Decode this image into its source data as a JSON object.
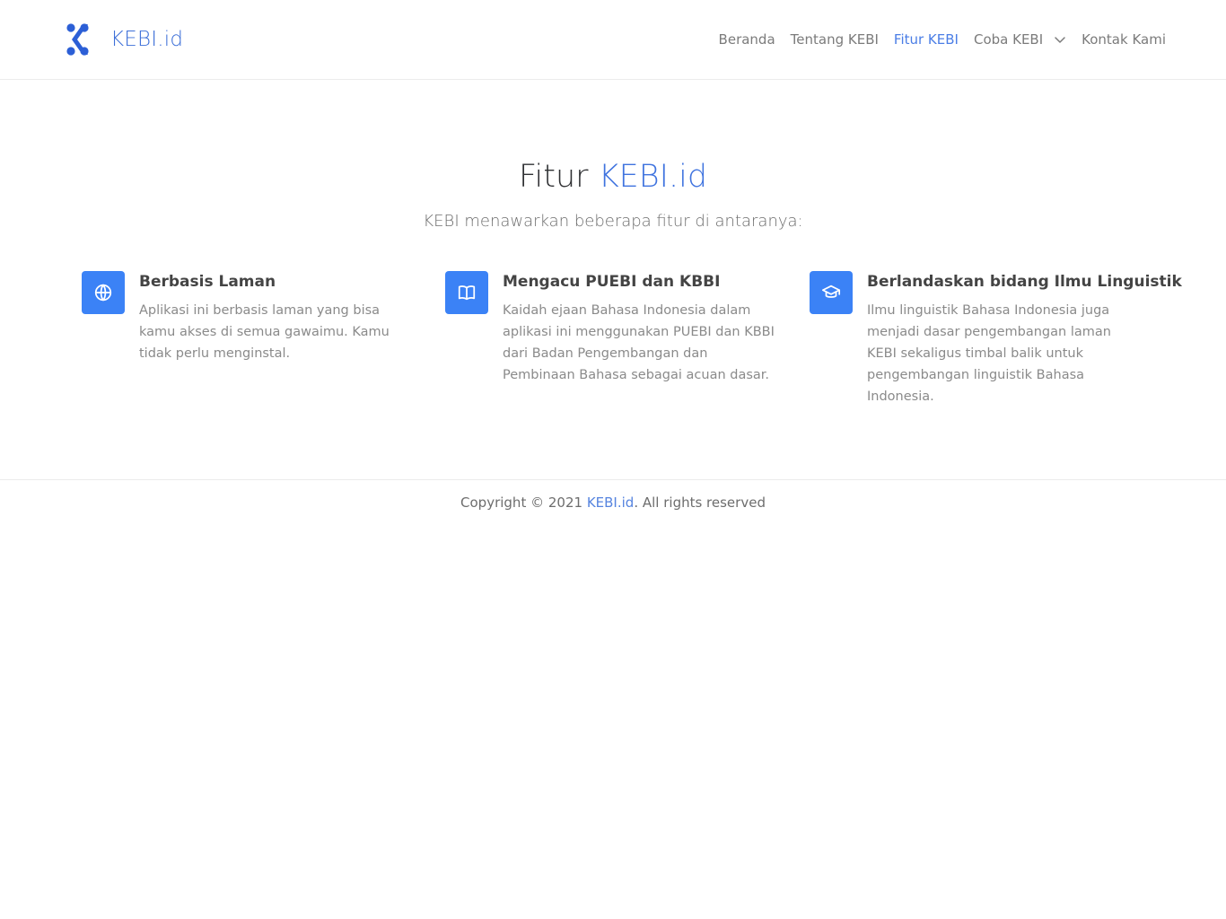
{
  "header": {
    "brand_name": "KEBI.id",
    "logo_icon": "kebi-logo-icon",
    "nav": [
      {
        "label": "Beranda"
      },
      {
        "label": "Tentang KEBI"
      },
      {
        "label": "Fitur KEBI",
        "active": true
      },
      {
        "label": "Coba KEBI",
        "has_dropdown": true,
        "dropdown_icon": "chevron-down-icon"
      },
      {
        "label": "Kontak Kami"
      }
    ]
  },
  "features_section": {
    "title_prefix": "Fitur",
    "title_accent": "KEBI.id",
    "subtitle": "KEBI menawarkan beberapa fitur di antaranya:",
    "items": [
      {
        "icon": "globe-icon",
        "title": "Berbasis Laman",
        "description": "Aplikasi ini berbasis laman yang bisa kamu akses di semua gawaimu. Kamu tidak perlu menginstal."
      },
      {
        "icon": "book-icon",
        "title": "Mengacu PUEBI dan KBBI",
        "description": "Kaidah ejaan Bahasa Indonesia dalam aplikasi ini menggunakan PUEBI dan KBBI dari Badan Pengembangan dan Pembinaan Bahasa sebagai acuan dasar."
      },
      {
        "icon": "graduation-cap-icon",
        "title": "Berlandaskan bidang Ilmu Linguistik",
        "description": "Ilmu linguistik Bahasa Indonesia juga menjadi dasar pengembangan laman KEBI sekaligus timbal balik untuk pengembangan linguistik Bahasa Indonesia."
      }
    ]
  },
  "footer": {
    "prefix": "Copyright © 2021",
    "link_text": "KEBI.id",
    "suffix": ". All rights reserved"
  },
  "colors": {
    "accent": "#3f73df",
    "icon_bg": "#3b82f6",
    "nav_active": "#4b7ee6"
  }
}
